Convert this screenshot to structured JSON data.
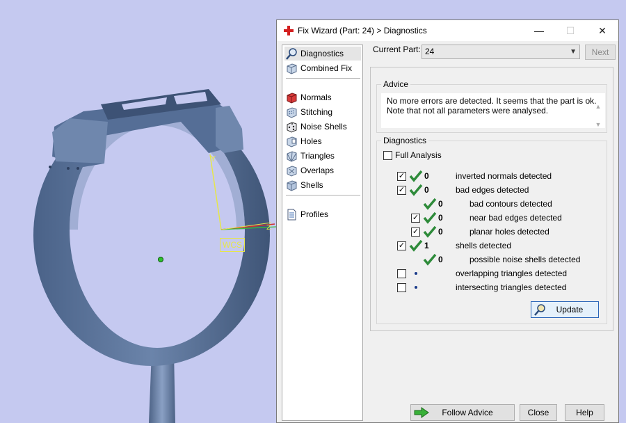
{
  "viewport": {
    "wcs_label": "WCS",
    "axis_y_label": "Y",
    "axis_z_label": "Z"
  },
  "dialog": {
    "title": "Fix Wizard (Part: 24) > Diagnostics",
    "window_buttons": {
      "minimize": "—",
      "maximize": "☐",
      "close": "✕"
    }
  },
  "nav": {
    "items": [
      {
        "label": "Diagnostics",
        "icon": "magnifier-icon",
        "selected": true
      },
      {
        "label": "Combined Fix",
        "icon": "cube-icon"
      },
      {
        "label": "Normals",
        "icon": "red-cube-icon"
      },
      {
        "label": "Stitching",
        "icon": "stitching-icon"
      },
      {
        "label": "Noise Shells",
        "icon": "noise-dice-icon"
      },
      {
        "label": "Holes",
        "icon": "holes-icon"
      },
      {
        "label": "Triangles",
        "icon": "triangles-icon"
      },
      {
        "label": "Overlaps",
        "icon": "overlaps-icon"
      },
      {
        "label": "Shells",
        "icon": "shells-icon"
      },
      {
        "label": "Profiles",
        "icon": "document-icon"
      }
    ]
  },
  "current_part": {
    "label": "Current Part:",
    "value": "24",
    "next": "Next"
  },
  "advice": {
    "title": "Advice",
    "line1": "No more errors are detected. It seems that the part is ok.",
    "line2": "Note that not all parameters were analysed."
  },
  "diagnostics": {
    "title": "Diagnostics",
    "full_analysis": "Full Analysis",
    "rows": [
      {
        "count": "0",
        "label": "inverted normals detected"
      },
      {
        "count": "0",
        "label": "bad edges detected"
      },
      {
        "count": "0",
        "label": "bad contours detected"
      },
      {
        "count": "0",
        "label": "near bad edges detected"
      },
      {
        "count": "0",
        "label": "planar holes detected"
      },
      {
        "count": "1",
        "label": "shells detected"
      },
      {
        "count": "0",
        "label": "possible noise shells detected"
      },
      {
        "count": "",
        "label": "overlapping triangles detected"
      },
      {
        "count": "",
        "label": "intersecting triangles detected"
      }
    ],
    "update": "Update"
  },
  "buttons": {
    "follow_advice": "Follow Advice",
    "close": "Close",
    "help": "Help"
  },
  "colors": {
    "background": "#c5c9f0",
    "model": "#5a7299",
    "accent_check": "#2e8b3a"
  }
}
